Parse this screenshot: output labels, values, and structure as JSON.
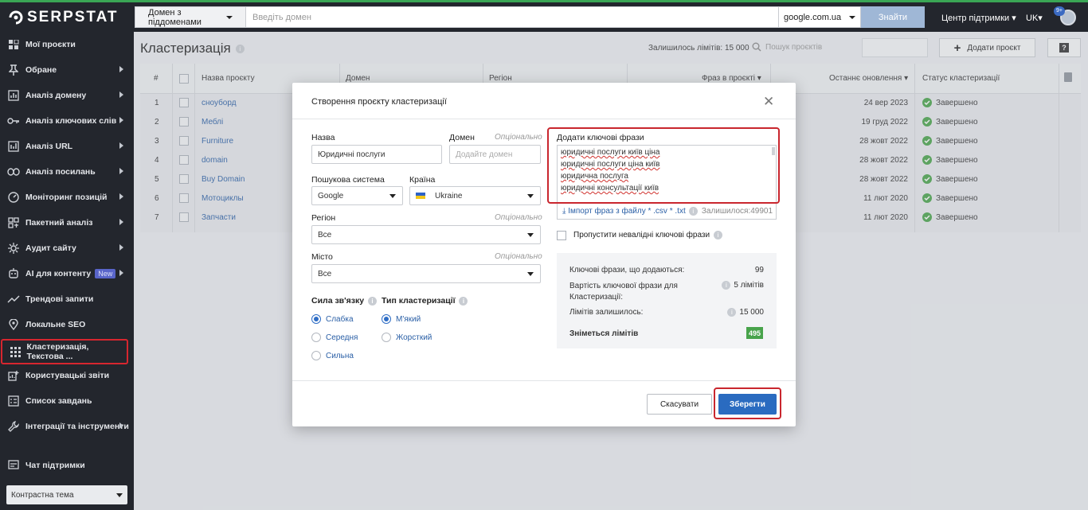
{
  "brand": {
    "logo_text": "SERPSTAT"
  },
  "topbar": {
    "domain_mode": "Домен з піддоменами",
    "domain_placeholder": "Введіть домен",
    "database": "google.com.ua",
    "find_label": "Знайти",
    "support": "Центр підтримки",
    "lang": "UK",
    "notif_count": "9+"
  },
  "sidebar": {
    "items": [
      {
        "label": "Мої проєкти"
      },
      {
        "label": "Обране"
      },
      {
        "label": "Аналіз домену"
      },
      {
        "label": "Аналіз ключових слів"
      },
      {
        "label": "Аналіз URL"
      },
      {
        "label": "Аналіз посилань"
      },
      {
        "label": "Моніторинг позицій"
      },
      {
        "label": "Пакетний аналіз"
      },
      {
        "label": "Аудит сайту"
      },
      {
        "label": "AI для контенту",
        "badge": "New"
      },
      {
        "label": "Трендові запити"
      },
      {
        "label": "Локальне SEO"
      },
      {
        "label": "Кластеризація, Текстова ..."
      },
      {
        "label": "Користувацькі звіти"
      },
      {
        "label": "Список завдань"
      },
      {
        "label": "Інтеграції та інструменти"
      },
      {
        "label": "Чат підтримки"
      }
    ],
    "theme": "Контрастна тема"
  },
  "page": {
    "title": "Кластеризація",
    "limits": "Залишилось лімітів: 15 000",
    "search_placeholder": "Пошук проєктів",
    "add_project": "Додати проєкт",
    "help": "?"
  },
  "table": {
    "headers": {
      "num": "#",
      "name": "Назва проєкту",
      "domain": "Домен",
      "region": "Регіон",
      "phrases": "Фраз в проєкті",
      "updated": "Останнє оновлення",
      "status": "Статус кластеризації"
    },
    "rows": [
      {
        "num": "1",
        "name": "сноуборд",
        "date": "24 вер 2023",
        "status": "Завершено"
      },
      {
        "num": "2",
        "name": "Меблі",
        "date": "19 груд 2022",
        "status": "Завершено"
      },
      {
        "num": "3",
        "name": "Furniture",
        "date": "28 жовт 2022",
        "status": "Завершено"
      },
      {
        "num": "4",
        "name": "domain",
        "date": "28 жовт 2022",
        "status": "Завершено"
      },
      {
        "num": "5",
        "name": "Buy Domain",
        "date": "28 жовт 2022",
        "status": "Завершено"
      },
      {
        "num": "6",
        "name": "Мотоциклы",
        "date": "11 лют 2020",
        "status": "Завершено"
      },
      {
        "num": "7",
        "name": "Запчасти",
        "date": "11 лют 2020",
        "status": "Завершено"
      }
    ]
  },
  "modal": {
    "title": "Створення проєкту кластеризації",
    "name_label": "Назва",
    "name_value": "Юридичні послуги",
    "domain_label": "Домен",
    "optional": "Опціонально",
    "domain_placeholder": "Додайте домен",
    "engine_label": "Пошукова система",
    "engine_value": "Google",
    "country_label": "Країна",
    "country_value": "Ukraine",
    "region_label": "Регіон",
    "region_value": "Все",
    "city_label": "Місто",
    "city_value": "Все",
    "strength_label": "Сила зв'язку",
    "strength_options": [
      "Слабка",
      "Середня",
      "Сильна"
    ],
    "type_label": "Тип кластеризації",
    "type_options": [
      "М'який",
      "Жорсткий"
    ],
    "keywords_label": "Додати ключові фрази",
    "keywords": [
      "юридичні послуги київ ціна",
      "юридичні послуги ціна київ",
      "юридична послуга",
      "юридичні консультації київ"
    ],
    "import_label": "Імпорт фраз з файлу * .csv * .txt",
    "import_remaining": "Залишилося:49901",
    "skip_label": "Пропустити невалідні ключові фрази",
    "summary": {
      "added_label": "Ключові фрази, що додаються:",
      "added_value": "99",
      "cost_label": "Вартість ключової фрази для Кластеризації:",
      "cost_value": "5 лімітів",
      "left_label": "Лімітів залишилось:",
      "left_value": "15 000",
      "charge_label": "Зніметься лімітів",
      "charge_value": "495"
    },
    "cancel": "Скасувати",
    "save": "Зберегти"
  }
}
